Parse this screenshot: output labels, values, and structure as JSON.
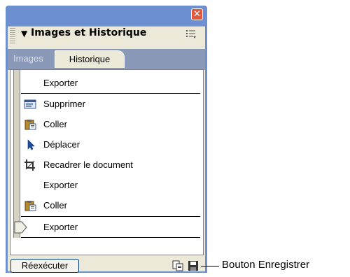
{
  "panel": {
    "title": "Images et Historique",
    "tabs": [
      {
        "label": "Images",
        "active": false
      },
      {
        "label": "Historique",
        "active": true
      }
    ]
  },
  "history": {
    "items": [
      {
        "label": "Exporter",
        "icon": "none"
      },
      {
        "label": "Supprimer",
        "icon": "delete-icon"
      },
      {
        "label": "Coller",
        "icon": "paste-icon"
      },
      {
        "label": "Déplacer",
        "icon": "pointer-arrow-icon"
      },
      {
        "label": "Recadrer le document",
        "icon": "crop-icon"
      },
      {
        "label": "Exporter",
        "icon": "none"
      },
      {
        "label": "Coller",
        "icon": "paste-icon"
      },
      {
        "label": "Exporter",
        "icon": "none"
      }
    ]
  },
  "footer": {
    "replay_label": "Réexécuter"
  },
  "callout": {
    "text": "Bouton Enregistrer"
  },
  "colors": {
    "frame": "#6b8fcf",
    "close": "#e2583c",
    "panel_bg": "#ece9d8",
    "tab_strip": "#8a99b8"
  }
}
